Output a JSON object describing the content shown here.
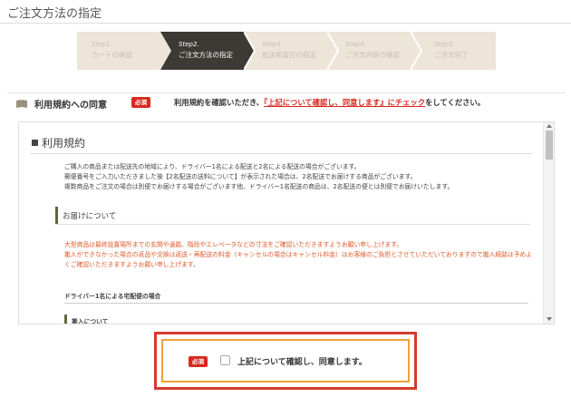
{
  "page": {
    "title": "ご注文方法の指定"
  },
  "steps": [
    {
      "num": "Step1.",
      "label": "カートの確認",
      "active": false
    },
    {
      "num": "Step2.",
      "label": "ご注文方法の指定",
      "active": true
    },
    {
      "num": "Step3.",
      "label": "配送希望日の指定",
      "active": false
    },
    {
      "num": "Step4.",
      "label": "ご注文内容の確認",
      "active": false
    },
    {
      "num": "Step5.",
      "label": "ご注文完了",
      "active": false
    }
  ],
  "agreement": {
    "title": "利用規約への同意",
    "required_badge": "必須",
    "msg_prefix": "利用規約を確認いただき、",
    "msg_highlight": "『上記について確認し、同意します』にチェック",
    "msg_suffix": "をしてください。"
  },
  "terms": {
    "title": "利用規約",
    "paragraph1": [
      "ご購入の商品または配送先の地域により、ドライバー1名による配送と2名による配送の場合がございます。",
      "郵便番号をご入力いただきました後【2名配送の送料について】が表示された場合は、2名配送でお届けする商品がございます。",
      "複数商品をご注文の場合は別便でお届けする場合がございます他、ドライバー1名配送の商品は、2名配送の便とは別便でお届けいたします。"
    ],
    "section1": "お届けについて",
    "paragraph2": [
      "大型商品は最終設置場所までの玄関や通路、階段やエレベータなどの寸法をご確認いただきますようお願い申し上げます。",
      "搬入ができなかった場合の返品や交換は返送・再配送の料金（キャンセルの場合はキャンセル料金）はお客様のご負担とさせていただいておりますので搬入経路は予めよくご確認いただきますようお願い申し上げます。"
    ],
    "subheading1": "ドライバー1名による宅配便の場合",
    "subheading2": "搬入について"
  },
  "consent": {
    "required_badge": "必須",
    "label": "上記について確認し、同意します。",
    "checked": false
  },
  "colors": {
    "accent_red": "#d9271f",
    "orange_border": "#f0a13a",
    "step_active": "#3d3a36",
    "step_inactive": "#ece5d8"
  }
}
